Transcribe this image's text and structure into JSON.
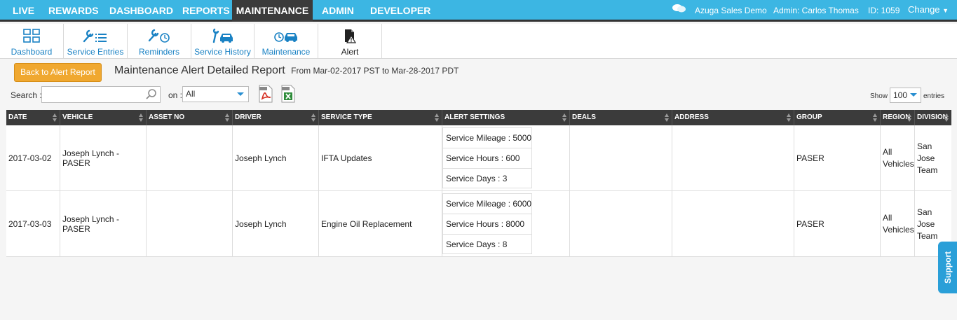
{
  "topnav": {
    "items": [
      "LIVE",
      "REWARDS",
      "DASHBOARD",
      "REPORTS",
      "MAINTENANCE",
      "ADMIN",
      "DEVELOPER"
    ],
    "account": "Azuga Sales Demo",
    "admin": "Admin: Carlos Thomas",
    "id": "ID: 1059",
    "change": "Change"
  },
  "subnav": {
    "tabs": [
      {
        "label": "Dashboard",
        "icon": "dashboard-grid-icon"
      },
      {
        "label": "Service Entries",
        "icon": "wrench-list-icon"
      },
      {
        "label": "Reminders",
        "icon": "wrench-clock-icon"
      },
      {
        "label": "Service History",
        "icon": "wrench-car-icon"
      },
      {
        "label": "Maintenance",
        "icon": "clock-car-icon"
      },
      {
        "label": "Alert",
        "icon": "alert-document-icon"
      }
    ]
  },
  "toolbar": {
    "back_label": "Back to Alert Report",
    "title": "Maintenance Alert Detailed Report",
    "range": "From Mar-02-2017 PST to Mar-28-2017 PDT",
    "search_label": "Search :",
    "search_value": "",
    "on_label": "on :",
    "on_value": "All",
    "show_label": "Show",
    "show_value": "100",
    "entries_label": "entries"
  },
  "table": {
    "headers": [
      "DATE",
      "VEHICLE",
      "ASSET NO",
      "DRIVER",
      "SERVICE TYPE",
      "ALERT SETTINGS",
      "DEALS",
      "ADDRESS",
      "GROUP",
      "REGION",
      "DIVISION"
    ],
    "rows": [
      {
        "date": "2017-03-02",
        "vehicle": "Joseph Lynch - PASER",
        "asset_no": "",
        "driver": "Joseph Lynch",
        "service_type": "IFTA Updates",
        "alerts": [
          "Service Mileage : 5000",
          "Service Hours : 600",
          "Service Days : 3"
        ],
        "deals": "",
        "address": "",
        "group": "PASER",
        "region_1": "All",
        "region_2": "Vehicles",
        "division_1": "San Jose",
        "division_2": "Team"
      },
      {
        "date": "2017-03-03",
        "vehicle": "Joseph Lynch - PASER",
        "asset_no": "",
        "driver": "Joseph Lynch",
        "service_type": "Engine Oil Replacement",
        "alerts": [
          "Service Mileage : 6000",
          "Service Hours : 8000",
          "Service Days : 8"
        ],
        "deals": "",
        "address": "",
        "group": "PASER",
        "region_1": "All",
        "region_2": "Vehicles",
        "division_1": "San Jose",
        "division_2": "Team"
      }
    ]
  },
  "support_label": "Support",
  "colors": {
    "topbar": "#3cb6e3",
    "active_tab": "#3b3b3b",
    "link": "#1a82c4",
    "button": "#f0a830"
  }
}
